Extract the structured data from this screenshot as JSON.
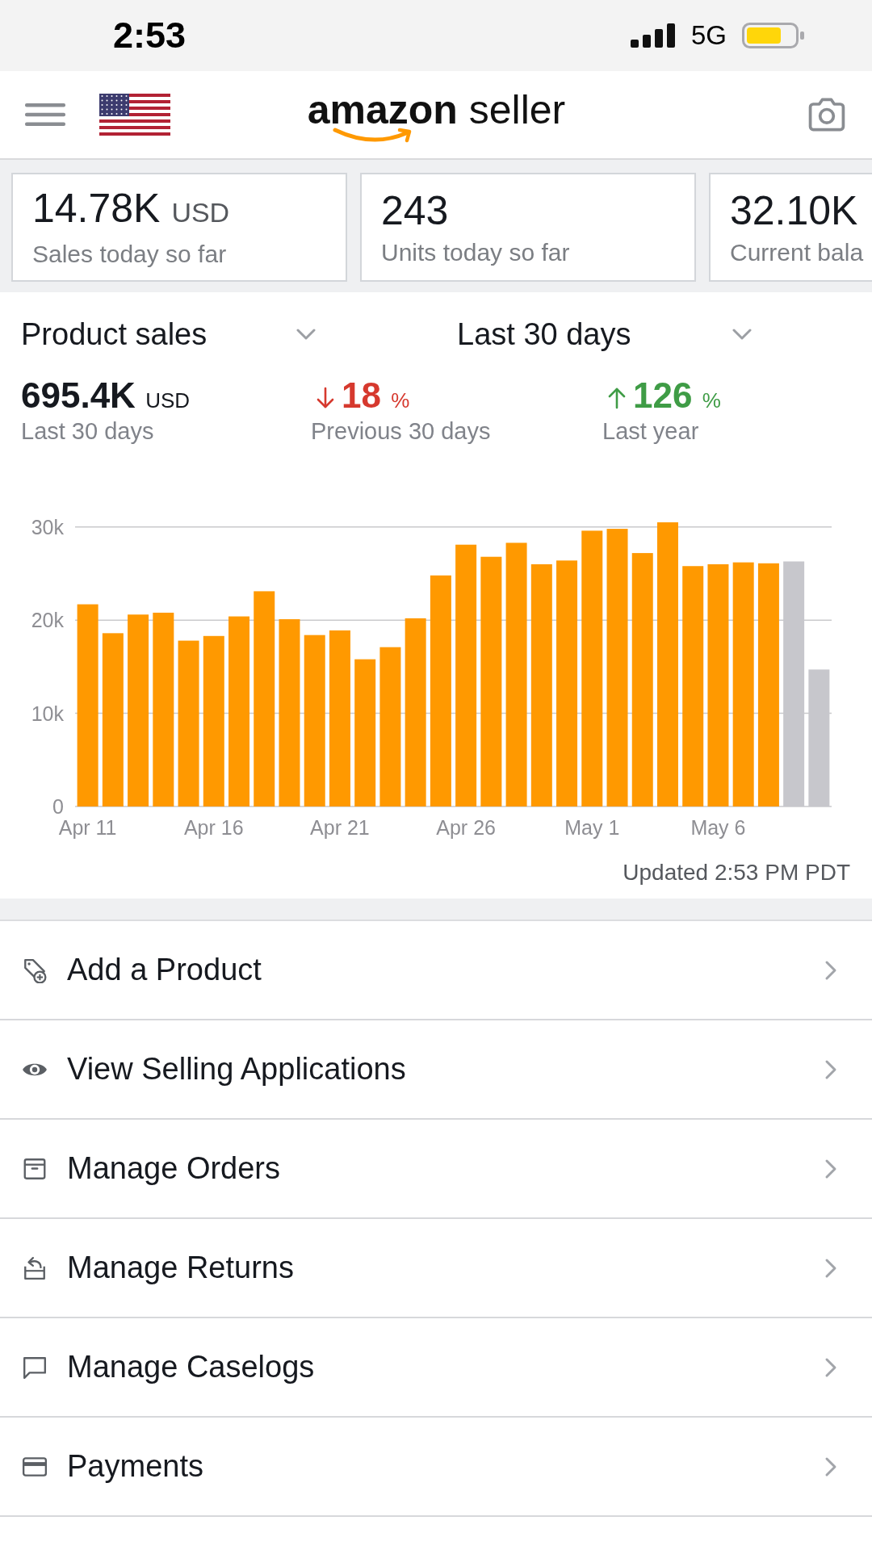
{
  "status_bar": {
    "time": "2:53",
    "network": "5G"
  },
  "header": {
    "logo": "**amazon** seller"
  },
  "summary_cards": [
    {
      "value": "14.78K",
      "unit": "USD",
      "label": "Sales today so far"
    },
    {
      "value": "243",
      "label": "Units today so far"
    },
    {
      "value": "32.10K",
      "label": "Current bala"
    }
  ],
  "filters": [
    {
      "label": "Product sales"
    },
    {
      "label": "Last 30 days"
    }
  ],
  "stats": [
    {
      "kind": "total",
      "value": "695.4K",
      "unit": "USD",
      "label": "Last 30 days"
    },
    {
      "kind": "decrease",
      "value": "18",
      "unit": "%",
      "label": "Previous 30 days"
    },
    {
      "kind": "increase",
      "value": "126",
      "unit": "%",
      "label": "Last year"
    }
  ],
  "chart": {
    "chart_data": {
      "type": "bar",
      "categories": [
        "Apr 11",
        null,
        null,
        null,
        null,
        "Apr 16",
        null,
        null,
        null,
        null,
        "Apr 21",
        null,
        null,
        null,
        null,
        "Apr 26",
        null,
        null,
        null,
        null,
        "May 1",
        null,
        null,
        null,
        null,
        "May 6",
        null,
        null,
        null,
        null
      ],
      "series": [
        {
          "color": "#ff9900",
          "values": [
            21700,
            18600,
            20600,
            20800,
            17800,
            18300,
            20400,
            23100,
            20100,
            18400,
            18900,
            15800,
            17100,
            20200,
            24800,
            28100,
            26800,
            28300,
            26000,
            26400,
            29600,
            29800,
            27200,
            30500,
            25800,
            26000,
            26200,
            26100,
            null,
            null
          ]
        },
        {
          "color": "#c7c7cc",
          "values": [
            null,
            null,
            null,
            null,
            null,
            null,
            null,
            null,
            null,
            null,
            null,
            null,
            null,
            null,
            null,
            null,
            null,
            null,
            null,
            null,
            null,
            null,
            null,
            null,
            null,
            null,
            null,
            null,
            26300,
            14700
          ]
        }
      ],
      "stacked": true,
      "grid": true,
      "ylim": [
        0,
        30500
      ],
      "yticks": [
        0,
        {
          "value": 10000,
          "label": "10k"
        },
        {
          "value": 20000,
          "label": "20k"
        },
        {
          "value": 30000,
          "label": "30k"
        }
      ]
    },
    "updated": "Updated 2:53 PM PDT"
  },
  "menu": [
    {
      "label": "Add a Product"
    },
    {
      "label": "View Selling Applications"
    },
    {
      "label": "Manage Orders"
    },
    {
      "label": "Manage Returns"
    },
    {
      "label": "Manage Caselogs"
    },
    {
      "label": "Payments"
    }
  ]
}
